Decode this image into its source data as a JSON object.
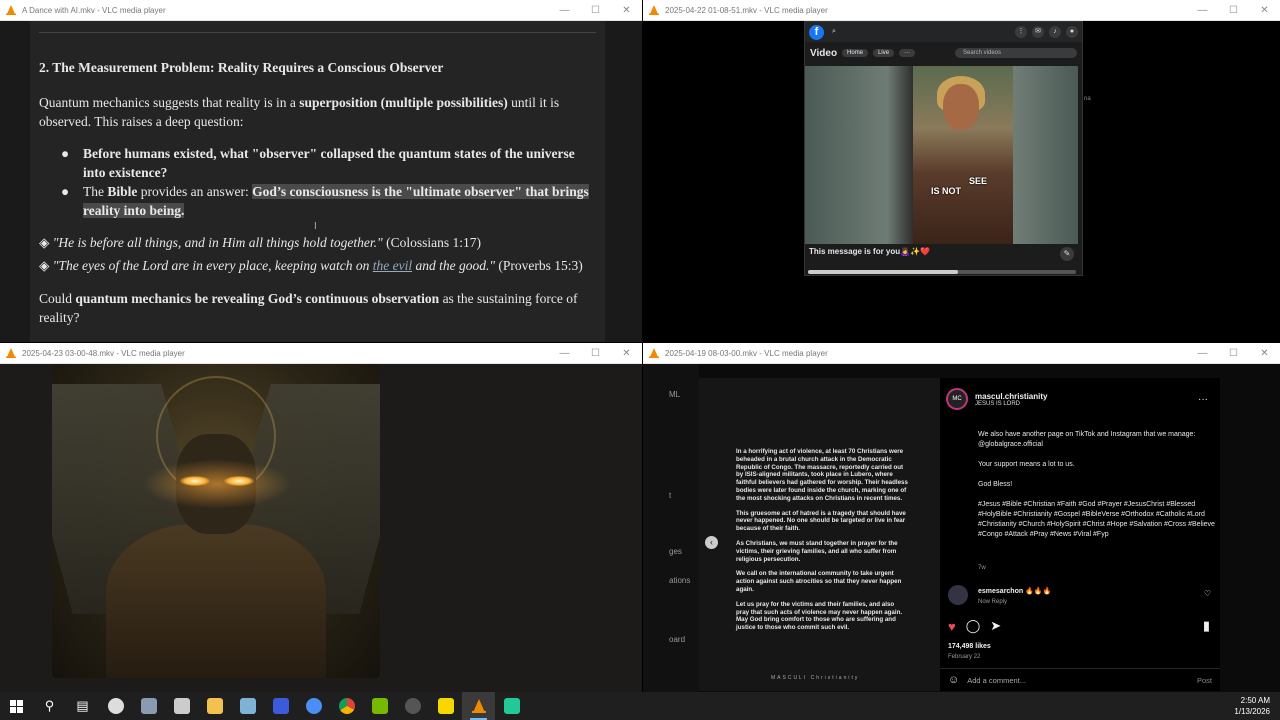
{
  "window1": {
    "title": "A Dance with AI.mkv - VLC media player",
    "heading": "2. The Measurement Problem: Reality Requires a Conscious Observer",
    "para1_a": "Quantum mechanics suggests that reality is in a ",
    "para1_b": "superposition (multiple possibilities)",
    "para1_c": " until it is observed. This raises a deep question:",
    "bullet1": "Before humans existed, what \"observer\" collapsed the quantum states of the universe into existence?",
    "bullet2_a": "The ",
    "bullet2_b": "Bible",
    "bullet2_c": " provides an answer: ",
    "bullet2_d": "God’s consciousness is the \"ultimate observer\" that brings reality into being.",
    "quote1_text": "\"He is before all things, and in Him all things hold together.\"",
    "quote1_ref": " (Colossians 1:17)",
    "quote2_a": "\"The eyes of the Lord are in every place, keeping watch on ",
    "quote2_link": "the evil",
    "quote2_b": " and the good.\"",
    "quote2_ref": " (Proverbs 15:3)",
    "para2_a": "Could ",
    "para2_b": "quantum mechanics be revealing God’s continuous observation",
    "para2_c": " as the sustaining force of reality?"
  },
  "window2": {
    "title": "2025-04-22 01-08-51.mkv - VLC media player",
    "fb_video_label": "Video",
    "fb_home": "Home",
    "fb_live": "Live",
    "fb_search_placeholder": "Search videos",
    "caption_left": "IS NOT",
    "caption_right": "SEE",
    "message": "This message is for you🙇‍♀️✨❤️",
    "side_text": "na",
    "scroll_fraction": 0.56
  },
  "window3": {
    "title": "2025-04-23 03-00-48.mkv - VLC media player"
  },
  "window4": {
    "title": "2025-04-19 08-03-00.mkv - VLC media player",
    "left_labels": [
      "ML",
      "t",
      "ges",
      "ations",
      "oard"
    ],
    "post_paragraphs": [
      "In a horrifying act of violence, at least 70 Christians were beheaded in a brutal church attack in the Democratic Republic of Congo. The massacre, reportedly carried out by ISIS-aligned militants, took place in Lubero, where faithful believers had gathered for worship. Their headless bodies were later found inside the church, marking one of the most shocking attacks on Christians in recent times.",
      "This gruesome act of hatred is a tragedy that should have never happened. No one should be targeted or live in fear because of their faith.",
      "As Christians, we must stand together in prayer for the victims, their grieving families, and all who suffer from religious persecution.",
      "We call on the international community to take urgent action against such atrocities so that they never happen again.",
      "Let us pray for the victims and their families, and also pray that such acts of violence may never happen again. May God bring comfort to those who are suffering and justice to those who commit such evil."
    ],
    "watermark": "MASCULI Christianity",
    "username": "mascul.christianity",
    "subtitle": "JESUS IS LORD",
    "avatar_text": "MC",
    "caption_p1": "We also have another page on TikTok and Instagram that we manage: @globalgrace.official",
    "caption_p2": "Your support means a lot to us.",
    "caption_p3": "God Bless!",
    "caption_tags": "#Jesus #Bible #Christian #Faith #God #Prayer #JesusChrist #Blessed #HolyBible #Christianity #Gospel #BibleVerse #Orthodox #Catholic #Lord #Christianity #Church #HolySpirit #Christ #Hope #Salvation #Cross #Believe #Congo #Attack #Pray #News #Viral #Fyp",
    "time_ago": "7w",
    "comment_user": "esmesarchon",
    "comment_text": "🔥🔥🔥",
    "comment_meta": "Now  Reply",
    "likes": "174,498 likes",
    "date": "February 22",
    "add_comment": "Add a comment...",
    "post_button": "Post"
  },
  "taskbar": {
    "time": "2:50 AM",
    "date": "1/13/2026"
  },
  "colors": {
    "fb_blue": "#1877f2",
    "ig_like": "#ed4956",
    "vlc_orange": "#f08a00"
  }
}
